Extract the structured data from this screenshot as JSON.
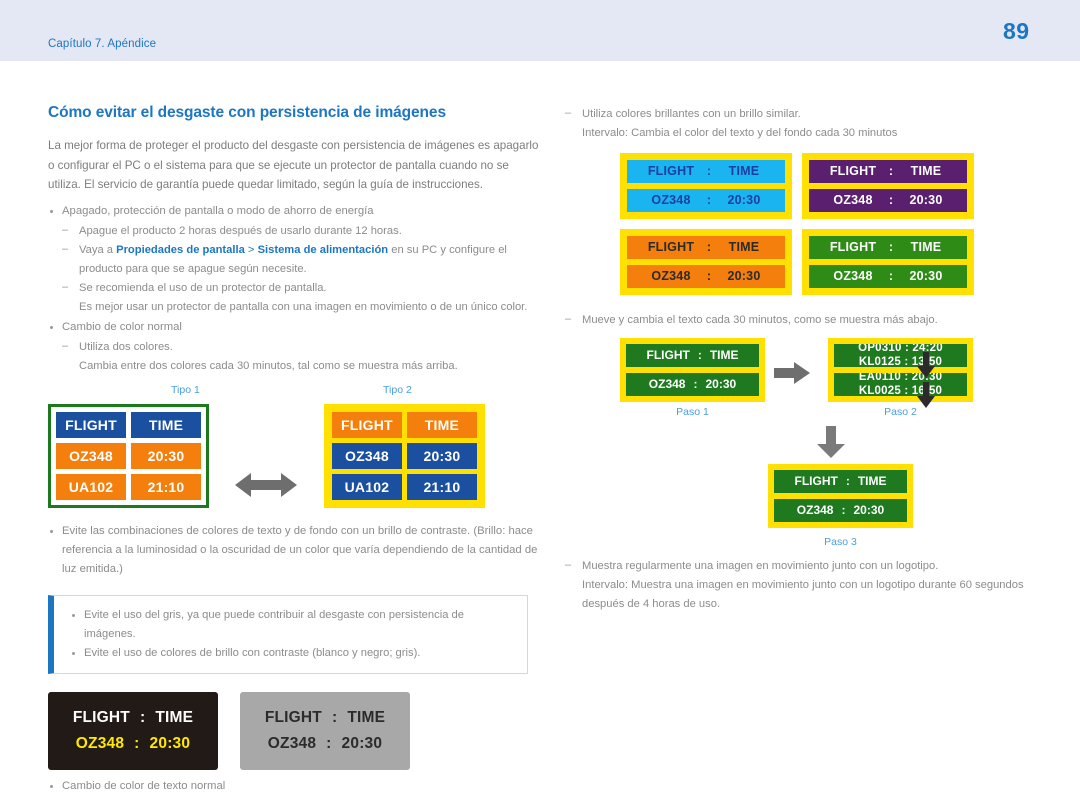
{
  "header": {
    "chapter": "Capítulo 7. Apéndice",
    "page_number": "89",
    "band_color": "#e4e8f5",
    "accent_color": "#1d76c4"
  },
  "left": {
    "title": "Cómo evitar el desgaste con persistencia de imágenes",
    "intro": "La mejor forma de proteger el producto del desgaste con persistencia de imágenes es apagarlo o configurar el PC o el sistema para que se ejecute un protector de pantalla cuando no se utiliza. El servicio de garantía puede quedar limitado, según la guía de instrucciones.",
    "bullet1": "Apagado, protección de pantalla o modo de ahorro de energía",
    "sub1": "Apague el producto 2 horas después de usarlo durante 12 horas.",
    "sub2_pre": "Vaya a ",
    "sub2_link1": "Propiedades de pantalla",
    "sub2_gt": " > ",
    "sub2_link2": "Sistema de alimentación",
    "sub2_post": " en su PC y configure el",
    "sub2_line2": "producto para que se apague según necesite.",
    "sub3": "Se recomienda el uso de un protector de pantalla.",
    "sub3_line2": "Es mejor usar un protector de pantalla con una imagen en movimiento o de un único color.",
    "bullet2": "Cambio de color normal",
    "sub4": "Utiliza dos colores.",
    "sub4_line2": "Cambia entre dos colores cada 30 minutos, tal como se muestra más arriba.",
    "tipo1_label": "Tipo 1",
    "tipo2_label": "Tipo 2",
    "bullet3": "Evite las combinaciones de colores de texto y de fondo con un brillo de contraste. (Brillo: hace referencia a la luminosidad o la oscuridad de un color que varía dependiendo de la cantidad de luz emitida.)",
    "note1": "Evite el uso del gris, ya que puede contribuir al desgaste con persistencia de imágenes.",
    "note2": "Evite el uso de colores de brillo con contraste (blanco y negro; gris).",
    "bullet4": "Cambio de color de texto normal"
  },
  "right": {
    "sub1": "Utiliza colores brillantes con un brillo similar.",
    "sub1_line2": "Intervalo: Cambia el color del texto y del fondo cada 30 minutos",
    "sub2": "Mueve y cambia el texto cada 30 minutos, como se muestra más abajo.",
    "paso1_label": "Paso 1",
    "paso2_label": "Paso 2",
    "paso3_label": "Paso 3",
    "sub3": "Muestra regularmente una imagen en movimiento junto con un logotipo.",
    "sub3_line2": "Intervalo: Muestra una imagen en movimiento junto con un logotipo durante 60 segundos",
    "sub3_line3": "después de 4 horas de uso."
  },
  "boards": {
    "labels": {
      "flight": "FLIGHT",
      "time": "TIME",
      "colon": ":",
      "flight_no": "OZ348",
      "flight_time": "20:30",
      "flight_no2": "UA102",
      "flight_time2": "21:10"
    },
    "tipo1": {
      "border_color": "#1b7a1b",
      "header_bg": "#1b4fa0",
      "header_fg": "#ffffff",
      "body_bg": "#f57f0c",
      "body_fg": "#ffffff",
      "rows": [
        [
          "FLIGHT",
          "TIME"
        ],
        [
          "OZ348",
          "20:30"
        ],
        [
          "UA102",
          "21:10"
        ]
      ]
    },
    "tipo2": {
      "border_color": "#ffe000",
      "header_bg": "#f57f0c",
      "header_fg": "#ffffff",
      "body_bg": "#1b4fa0",
      "body_fg": "#ffffff",
      "rows": [
        [
          "FLIGHT",
          "TIME"
        ],
        [
          "OZ348",
          "20:30"
        ],
        [
          "UA102",
          "21:10"
        ]
      ]
    },
    "panels": [
      {
        "name": "cyan-panel",
        "frame": "#ffe000",
        "cell_bg": "#1ab4f0",
        "cell_fg": "#1b3fa0",
        "rows": [
          [
            "FLIGHT",
            ":",
            "TIME"
          ],
          [
            "OZ348",
            ":",
            "20:30"
          ]
        ]
      },
      {
        "name": "purple-panel",
        "frame": "#ffe000",
        "cell_bg": "#5a1f6e",
        "cell_fg": "#ffffff",
        "rows": [
          [
            "FLIGHT",
            ":",
            "TIME"
          ],
          [
            "OZ348",
            ":",
            "20:30"
          ]
        ]
      },
      {
        "name": "orange-panel",
        "frame": "#ffe000",
        "cell_bg": "#f57f0c",
        "cell_fg": "#2b2b2b",
        "rows": [
          [
            "FLIGHT",
            ":",
            "TIME"
          ],
          [
            "OZ348",
            ":",
            "20:30"
          ]
        ]
      },
      {
        "name": "green-panel",
        "frame": "#ffe000",
        "cell_bg": "#2e8b16",
        "cell_fg": "#ffffff",
        "rows": [
          [
            "FLIGHT",
            ":",
            "TIME"
          ],
          [
            "OZ348",
            ":",
            "20:30"
          ]
        ]
      }
    ],
    "paso1": {
      "frame": "#ffe000",
      "cell_bg": "#1f7a1f",
      "cell_fg": "#ffffff",
      "rows": [
        [
          "FLIGHT",
          ":",
          "TIME"
        ],
        [
          "OZ348",
          ":",
          "20:30"
        ]
      ]
    },
    "paso2": {
      "frame": "#ffe000",
      "cell_bg": "#1f7a1f",
      "cell_fg": "#ffffff",
      "scroll_top": [
        "OP0310 : 24:20",
        "KL0125 : 13:50"
      ],
      "scroll_bottom": [
        "EA0110 : 20:30",
        "KL0025 : 16:50"
      ]
    },
    "paso3": {
      "frame": "#ffe000",
      "cell_bg": "#1f7a1f",
      "cell_fg": "#ffffff",
      "rows": [
        [
          "FLIGHT",
          ":",
          "TIME"
        ],
        [
          "OZ348",
          ":",
          "20:30"
        ]
      ]
    },
    "dark_board": {
      "bg": "#221a16",
      "header_fg": "#ffffff",
      "value_fg": "#ffe900",
      "rows": [
        [
          "FLIGHT",
          ":",
          "TIME"
        ],
        [
          "OZ348",
          ":",
          "20:30"
        ]
      ]
    },
    "gray_board": {
      "bg": "#a8a8a8",
      "header_fg": "#2b2b2b",
      "value_fg": "#2b2b2b",
      "rows": [
        [
          "FLIGHT",
          ":",
          "TIME"
        ],
        [
          "OZ348",
          ":",
          "20:30"
        ]
      ]
    }
  }
}
